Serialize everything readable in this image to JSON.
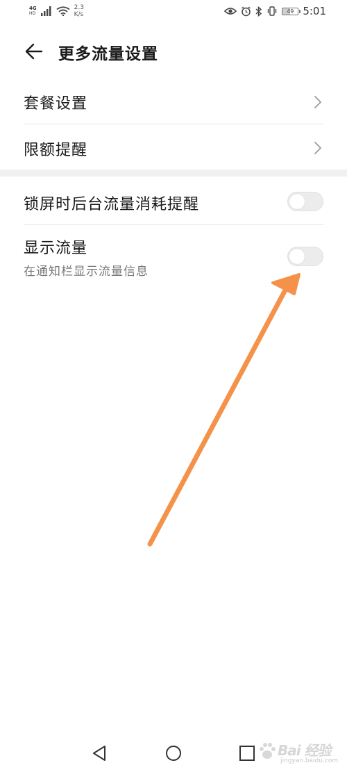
{
  "status_bar": {
    "network_type": "4G",
    "network_sub": "HD",
    "speed_value": "2.3",
    "speed_unit": "K/s",
    "battery_level": "49",
    "time": "5:01"
  },
  "header": {
    "title": "更多流量设置"
  },
  "settings": {
    "package_settings": "套餐设置",
    "limit_reminder": "限额提醒",
    "lock_screen_reminder": {
      "label": "锁屏时后台流量消耗提醒",
      "enabled": false
    },
    "show_traffic": {
      "label": "显示流量",
      "description": "在通知栏显示流量信息",
      "enabled": false
    }
  },
  "colors": {
    "annotation_arrow": "#F5924A",
    "toggle_off_track": "#ECECEC",
    "divider": "#E3E3E3",
    "section_gap": "#F1F1F1"
  },
  "watermark": {
    "brand": "Bai  经验",
    "url": "jingyan.baidu.com"
  }
}
